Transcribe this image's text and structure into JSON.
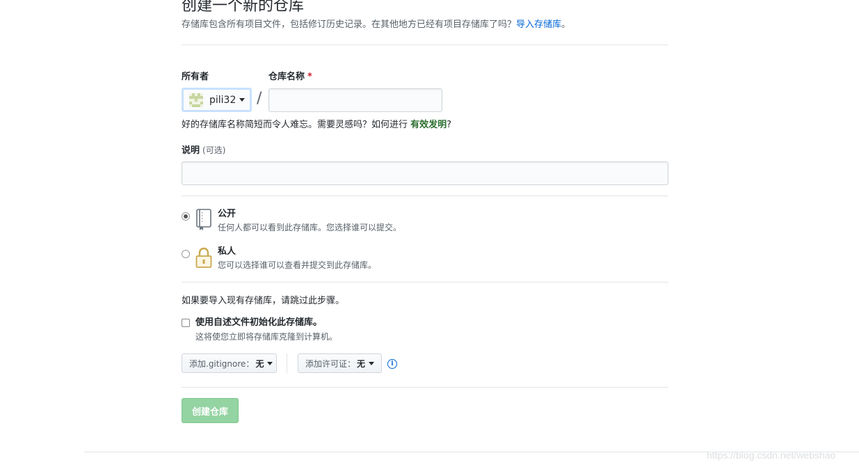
{
  "header": {
    "title": "创建一个新的仓库",
    "subtitle": "存储库包含所有项目文件，包括修订历史记录。在其他地方已经有项目存储库了吗？",
    "import_link": "导入存储库",
    "import_suffix": "。"
  },
  "owner": {
    "label": "所有者",
    "value": "pili32"
  },
  "repo_name": {
    "label": "仓库名称",
    "required_mark": "*",
    "value": "",
    "placeholder": ""
  },
  "name_hint": {
    "text": "好的存储库名称简短而令人难忘。需要灵感吗？如何进行",
    "suggestion": "有效发明",
    "suffix": "?"
  },
  "description": {
    "label": "说明",
    "optional": "(可选)",
    "value": ""
  },
  "visibility": {
    "public": {
      "title": "公开",
      "desc": "任何人都可以看到此存储库。您选择谁可以提交。",
      "checked": true
    },
    "private": {
      "title": "私人",
      "desc": "您可以选择谁可以查看并提交到此存储库。",
      "checked": false
    }
  },
  "import_note": "如果要导入现有存储库，请跳过此步骤。",
  "readme": {
    "title": "使用自述文件初始化此存储库。",
    "desc": "这将使您立即将存储库克隆到计算机。",
    "checked": false
  },
  "gitignore": {
    "label": "添加.gitignore：",
    "value": "无"
  },
  "license": {
    "label": "添加许可证：",
    "value": "无"
  },
  "info_icon": "info-icon",
  "submit_label": "创建仓库",
  "watermark": "https://blog.csdn.net/webshao",
  "colors": {
    "link": "#0366d6",
    "submit_bg": "#94d3a2",
    "required": "#cb2431",
    "lock_icon": "#c9a94e"
  }
}
